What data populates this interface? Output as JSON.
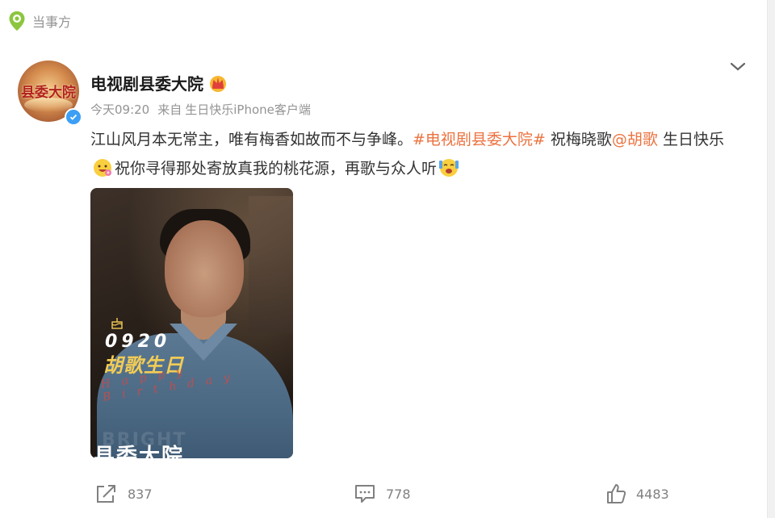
{
  "party": {
    "label": "当事方"
  },
  "author": {
    "name": "电视剧县委大院",
    "avatar_text": "县委大院"
  },
  "meta": {
    "time": "今天09:20",
    "source_prefix": "来自",
    "source": "生日快乐iPhone客户端"
  },
  "post": {
    "text_1": "江山风月本无常主，唯有梅香如故而不与争峰。",
    "hashtag": "#电视剧县委大院#",
    "text_2": " 祝梅晓歌",
    "mention": "@胡歌",
    "text_3": " 生日快乐",
    "text_4": "祝你寻得那处寄放真我的桃花源，再歌与众人听"
  },
  "image": {
    "date": "0920",
    "birthday": "胡歌生日",
    "script": "Happy Birthday",
    "bg_word": "BRIGHT",
    "show_title": "县委大院"
  },
  "actions": {
    "share_count": "837",
    "comment_count": "778",
    "like_count": "4483"
  },
  "colors": {
    "accent": "#eb7340",
    "muted": "#939393",
    "verify": "#3b9ff5"
  },
  "icons": [
    "location-pin-icon",
    "crown-badge-icon",
    "chevron-down-icon",
    "verified-icon",
    "cake-icon",
    "share-icon",
    "comment-icon",
    "like-icon",
    "laugh-flower-emoji",
    "cheer-emoji"
  ]
}
